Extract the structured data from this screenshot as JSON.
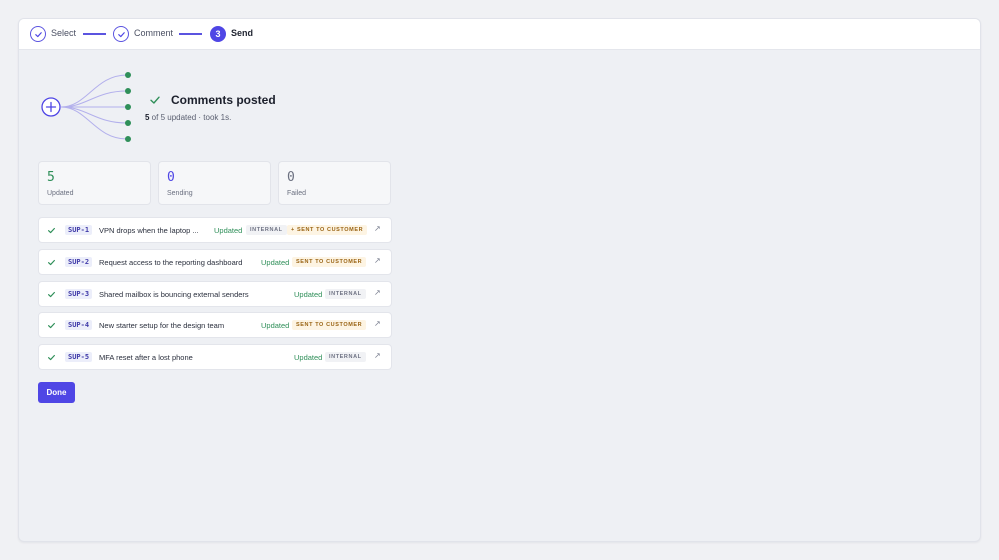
{
  "stepper": {
    "steps": [
      {
        "label": "Select",
        "status": "done"
      },
      {
        "label": "Comment",
        "status": "done"
      },
      {
        "label": "Send",
        "number": "3",
        "status": "current"
      }
    ]
  },
  "result": {
    "title": "Comments posted",
    "summary_count": "5",
    "summary_rest": " of 5 updated · took 1s."
  },
  "stats": [
    {
      "value": "5",
      "label": "Updated",
      "color": "#2f8f59"
    },
    {
      "value": "0",
      "label": "Sending",
      "color": "#4f46e5"
    },
    {
      "value": "0",
      "label": "Failed",
      "color": "#6b7080"
    }
  ],
  "rows": [
    {
      "key": "SUP-1",
      "title": "VPN drops when the laptop ...",
      "status": "Updated",
      "badges": [
        {
          "text": "INTERNAL",
          "kind": "internal"
        },
        {
          "text": "+ SENT TO CUSTOMER",
          "kind": "customer"
        }
      ]
    },
    {
      "key": "SUP-2",
      "title": "Request access to the reporting dashboard",
      "status": "Updated",
      "badges": [
        {
          "text": "SENT TO CUSTOMER",
          "kind": "customer"
        }
      ]
    },
    {
      "key": "SUP-3",
      "title": "Shared mailbox is bouncing external senders",
      "status": "Updated",
      "badges": [
        {
          "text": "INTERNAL",
          "kind": "internal"
        }
      ]
    },
    {
      "key": "SUP-4",
      "title": "New starter setup for the design team",
      "status": "Updated",
      "badges": [
        {
          "text": "SENT TO CUSTOMER",
          "kind": "customer"
        }
      ]
    },
    {
      "key": "SUP-5",
      "title": "MFA reset after a lost phone",
      "status": "Updated",
      "badges": [
        {
          "text": "INTERNAL",
          "kind": "internal"
        }
      ]
    }
  ],
  "actions": {
    "done_label": "Done"
  },
  "icons": {
    "step_done": "check-icon",
    "fanout": "fanout-diagram-icon",
    "row_status": "check-icon",
    "row_open": "external-link-icon"
  },
  "colors": {
    "accent": "#4f46e5",
    "success": "#2f8f59",
    "warning_text": "#9a6414"
  }
}
